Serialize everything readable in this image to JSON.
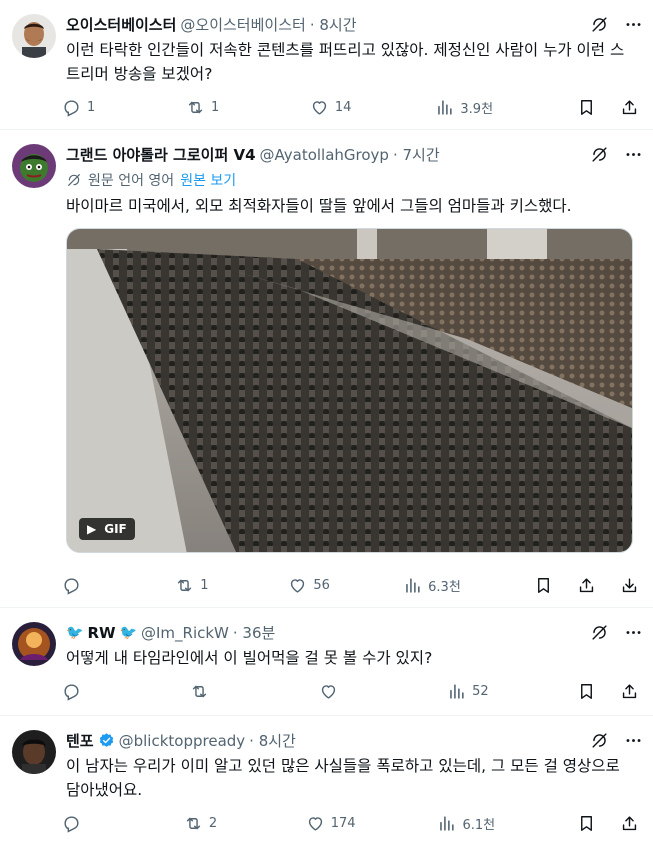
{
  "tweets": [
    {
      "display_name": "오이스터베이스터",
      "handle": "@오이스터베이스터",
      "time": "· 8시간",
      "text": "이런 타락한 인간들이 저속한 콘텐츠를 퍼뜨리고 있잖아. 제정신인 사람이 누가 이런 스트리머 방송을 보겠어?",
      "replies": "1",
      "reposts": "1",
      "likes": "14",
      "views": "3.9천"
    },
    {
      "display_name": "그랜드 아야톨라 그로이퍼 V4",
      "handle": "@AyatollahGroyp",
      "time": "· 7시간",
      "translate_note": "원문 언어 영어",
      "translate_link": "원본 보기",
      "text": "바이마르 미국에서, 외모 최적화자들이 딸들 앞에서 그들의 엄마들과 키스했다.",
      "media_badge": "GIF",
      "replies": "",
      "reposts": "1",
      "likes": "56",
      "views": "6.3천"
    },
    {
      "display_name": "RW",
      "handle": "@Im_RickW",
      "time": "· 36분",
      "text": "어떻게 내 타임라인에서 이 빌어먹을 걸 못 볼 수가 있지?",
      "replies": "",
      "reposts": "",
      "likes": "",
      "views": "52"
    },
    {
      "display_name": "텐포",
      "handle": "@blicktoppready",
      "time": "· 8시간",
      "text": "이 남자는 우리가 이미 알고 있던 많은 사실들을 폭로하고 있는데, 그 모든 걸 영상으로 담아냈어요.",
      "replies": "",
      "reposts": "2",
      "likes": "174",
      "views": "6.1천"
    }
  ],
  "colors": {
    "text": "#0f1419",
    "muted": "#536471",
    "accent": "#1d9bf0",
    "divider": "#eff3f4"
  },
  "icons": [
    "reply-icon",
    "repost-icon",
    "like-icon",
    "views-icon",
    "bookmark-icon",
    "share-icon",
    "grok-icon",
    "more-icon",
    "translate-icon",
    "verified-icon",
    "gif-play-icon"
  ]
}
